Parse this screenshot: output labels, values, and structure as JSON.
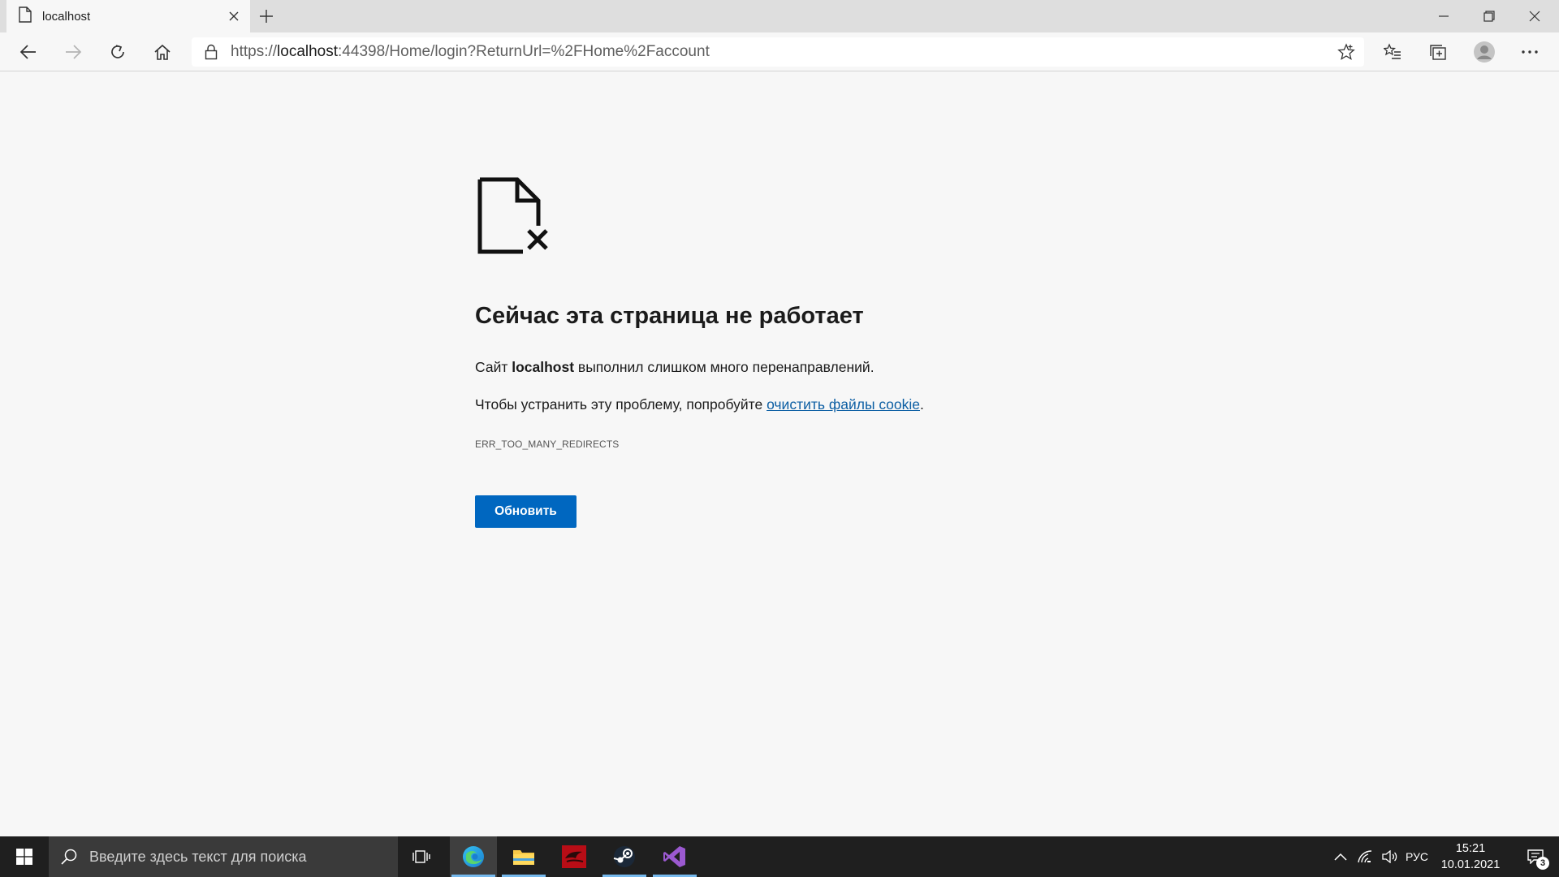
{
  "browser": {
    "tab": {
      "title": "localhost",
      "icon": "document-icon"
    },
    "address": {
      "scheme": "https://",
      "host": "localhost",
      "rest": ":44398/Home/login?ReturnUrl=%2FHome%2Faccount"
    }
  },
  "error_page": {
    "heading": "Сейчас эта страница не работает",
    "line1_prefix": "Сайт ",
    "line1_host": "localhost",
    "line1_suffix": " выполнил слишком много перенаправлений.",
    "line2_prefix": "Чтобы устранить эту проблему, попробуйте ",
    "line2_link": "очистить файлы cookie",
    "line2_suffix": ".",
    "error_code": "ERR_TOO_MANY_REDIRECTS",
    "reload_label": "Обновить",
    "accent_color": "#0067c0"
  },
  "taskbar": {
    "search_placeholder": "Введите здесь текст для поиска",
    "apps": [
      "edge",
      "file-explorer",
      "app-red",
      "steam",
      "visual-studio"
    ],
    "language": "РУС",
    "time": "15:21",
    "date": "10.01.2021",
    "notifications": "3"
  }
}
